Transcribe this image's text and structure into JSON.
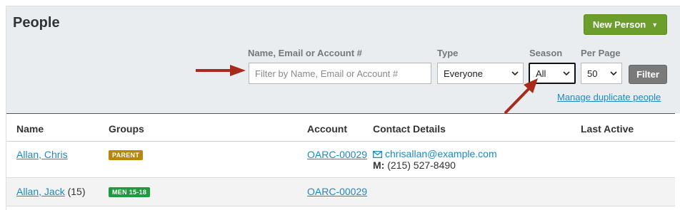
{
  "header": {
    "title": "People",
    "new_person_label": "New Person",
    "caret": "▼"
  },
  "filters": {
    "search": {
      "label": "Name, Email or Account #",
      "placeholder": "Filter by Name, Email or Account #",
      "value": ""
    },
    "type": {
      "label": "Type",
      "value": "Everyone"
    },
    "season": {
      "label": "Season",
      "value": "All"
    },
    "per_page": {
      "label": "Per Page",
      "value": "50"
    },
    "filter_label": "Filter",
    "manage_duplicates": "Manage duplicate people"
  },
  "table": {
    "headers": [
      "Name",
      "Groups",
      "Account",
      "Contact Details",
      "Last Active"
    ],
    "rows": [
      {
        "name": "Allan, Chris",
        "age": "",
        "group": "PARENT",
        "group_color": "#b8860b",
        "account": "OARC-00029",
        "email": "chrisallan@example.com",
        "phone_label": "M:",
        "phone": "(215) 527-8490",
        "last_active": ""
      },
      {
        "name": "Allan, Jack",
        "age": "(15)",
        "group": "MEN 15-18",
        "group_color": "#1e9b3c",
        "account": "OARC-00029",
        "email": "",
        "phone_label": "",
        "phone": "",
        "last_active": ""
      }
    ]
  },
  "icons": {
    "mail": "mail-icon",
    "dropdown": "chevron-down-icon",
    "annotation": "red-arrow"
  },
  "colors": {
    "accent_green": "#6b9e2a",
    "link_blue": "#1a8bc5",
    "annotation_red": "#a82a1a"
  }
}
